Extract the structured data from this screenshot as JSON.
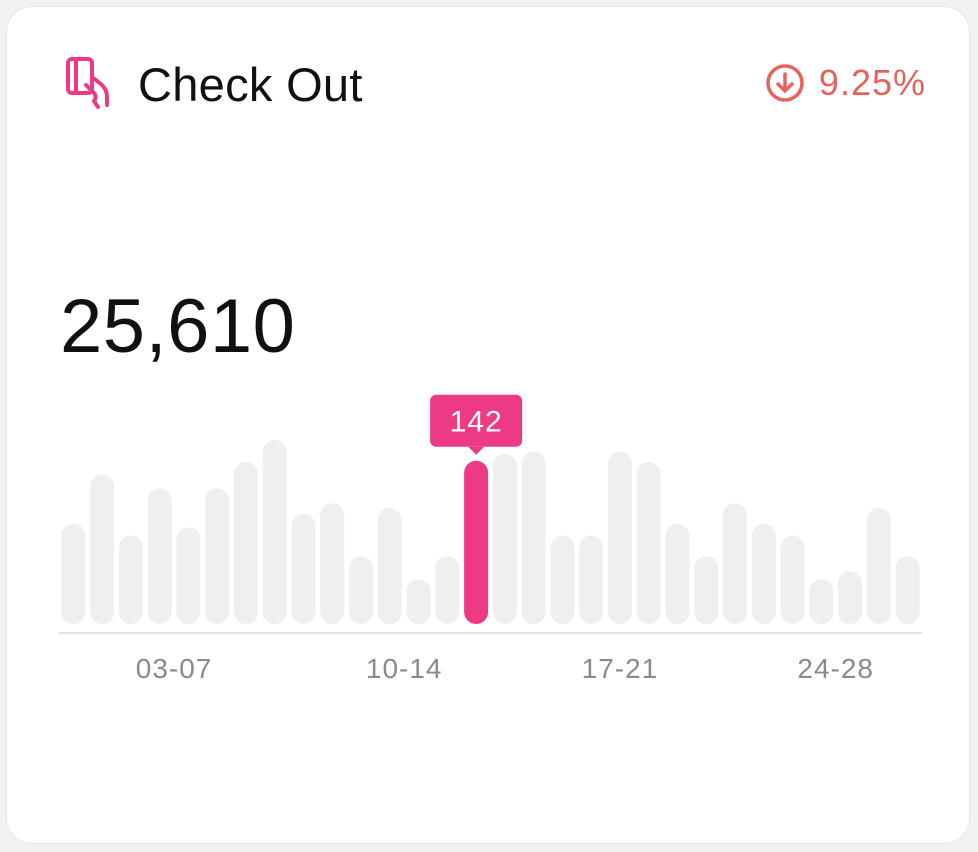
{
  "card": {
    "title": "Check Out",
    "icon": "card-in-hand-icon",
    "total": "25,610",
    "trend": {
      "direction": "down",
      "icon": "arrow-down-circle-icon",
      "value": "9.25%",
      "color": "#e5635c"
    }
  },
  "colors": {
    "accent": "#ec3b84",
    "bar": "#efefef",
    "axis": "#e4e4e6"
  },
  "chart_data": {
    "type": "bar",
    "ylim": [
      0,
      160
    ],
    "grid": false,
    "values": [
      87,
      130,
      77,
      118,
      84,
      118,
      141,
      160,
      96,
      105,
      59,
      101,
      39,
      59,
      142,
      148,
      150,
      77,
      77,
      150,
      141,
      87,
      59,
      105,
      87,
      77,
      39,
      46,
      101,
      59
    ],
    "highlight_index": 14,
    "tooltip": "142",
    "ticks": [
      {
        "index": 3.5,
        "label": "03-07"
      },
      {
        "index": 11.5,
        "label": "10-14"
      },
      {
        "index": 19,
        "label": "17-21"
      },
      {
        "index": 26.5,
        "label": "24-28"
      }
    ]
  }
}
